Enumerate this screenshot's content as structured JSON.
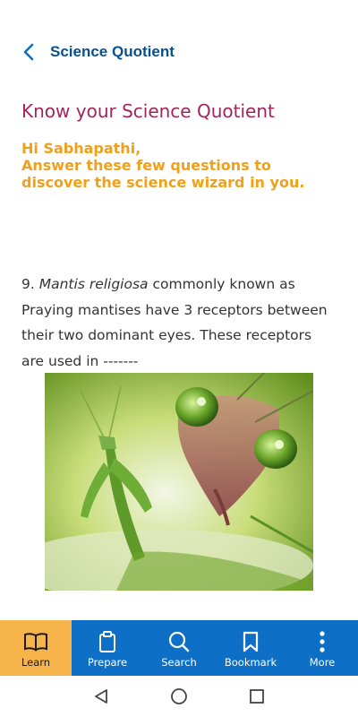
{
  "app_bar": {
    "title": "Science Quotient",
    "back_icon": "chevron-left-icon"
  },
  "content": {
    "heading": "Know your Science Quotient",
    "greeting_line1": "Hi Sabhapathi,",
    "greeting_line2": "Answer these few questions to discover the science wizard in you.",
    "question": {
      "number": "9.",
      "species": "Mantis religiosa",
      "text": " commonly known as Praying mantises have 3 receptors between their two dominant eyes. These receptors are used in -------"
    },
    "image_alt": "praying mantis photo"
  },
  "bottom_nav": {
    "items": [
      {
        "label": "Learn",
        "icon": "book-icon",
        "active": true
      },
      {
        "label": "Prepare",
        "icon": "clipboard-icon",
        "active": false
      },
      {
        "label": "Search",
        "icon": "search-icon",
        "active": false
      },
      {
        "label": "Bookmark",
        "icon": "bookmark-icon",
        "active": false
      },
      {
        "label": "More",
        "icon": "more-vertical-icon",
        "active": false
      }
    ]
  },
  "colors": {
    "title": "#0b4f8a",
    "heading": "#a3245c",
    "greeting": "#f0a019",
    "nav_bg": "#0d6fc6",
    "nav_active": "#f6b44a"
  }
}
